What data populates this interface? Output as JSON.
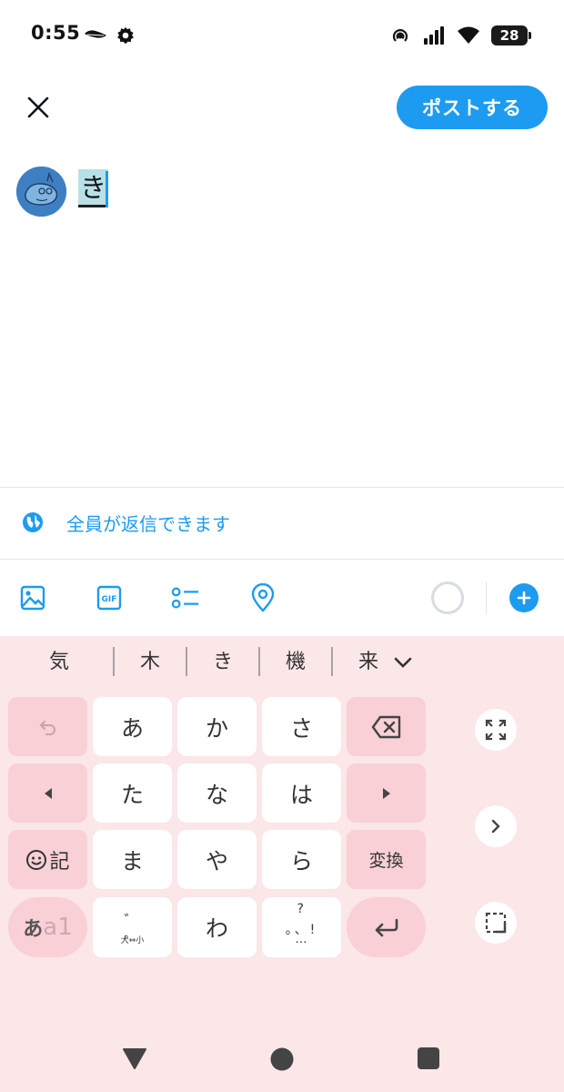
{
  "status_bar": {
    "time": "0:55",
    "battery": "28",
    "icons": [
      "app-notification-icon",
      "gear-icon",
      "hotspot-icon",
      "cell-signal-icon",
      "wifi-icon",
      "battery-icon"
    ]
  },
  "header": {
    "close_icon": "close-icon",
    "post_label": "ポストする"
  },
  "composer": {
    "text": "き",
    "avatar_icon": "avatar"
  },
  "reply_settings": {
    "label": "全員が返信できます",
    "icon": "globe-icon"
  },
  "toolbar": {
    "icons": [
      "image-icon",
      "gif-icon",
      "poll-icon",
      "location-icon",
      "character-count-ring",
      "add-post-icon"
    ],
    "gif_label": "GIF"
  },
  "keyboard": {
    "candidates": [
      "気",
      "木",
      "き",
      "機",
      "来"
    ],
    "rows": [
      [
        "undo",
        "あ",
        "か",
        "さ",
        "backspace"
      ],
      [
        "left",
        "た",
        "な",
        "は",
        "right"
      ],
      [
        "記",
        "ま",
        "や",
        "ら",
        "変換"
      ],
      [
        "あa1",
        "dakuten",
        "わ",
        "punct",
        "enter"
      ]
    ],
    "emoji_kigo_label": "記",
    "convert_label": "変換",
    "mode_label_1": "あ",
    "mode_label_2": "a1",
    "dakuten_top": "゛ ゜",
    "dakuten_bottom": "大⇔小",
    "punct_top": "?",
    "punct_mid": "。、!",
    "punct_bottom": "…",
    "colors": {
      "background": "#fbe6e8",
      "function_key": "#f8d0d6",
      "key": "#ffffff"
    }
  },
  "colors": {
    "accent": "#1d9bf0"
  }
}
